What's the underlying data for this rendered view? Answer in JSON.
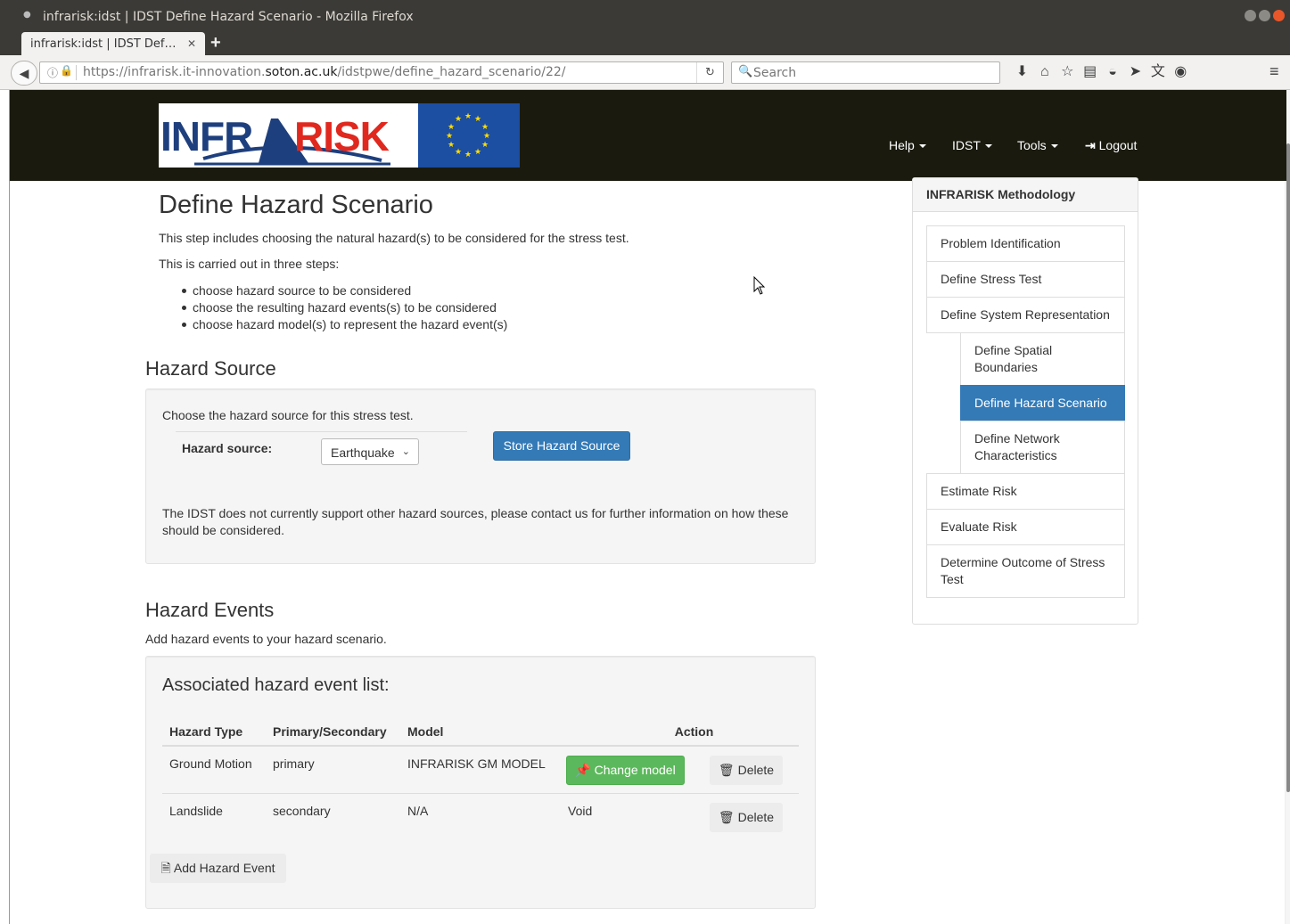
{
  "window": {
    "title": "infrarisk:idst | IDST Define Hazard Scenario - Mozilla Firefox",
    "tab_title": "infrarisk:idst | IDST Def…"
  },
  "browser": {
    "url_prefix": "https://infrarisk.it-innovation.",
    "url_domain": "soton.ac.uk",
    "url_path": "/idstpwe/define_hazard_scenario/22/",
    "search_placeholder": "Search"
  },
  "header": {
    "logo_left": "INFR",
    "logo_right": "RISK",
    "nav": [
      {
        "label": "Help"
      },
      {
        "label": "IDST"
      },
      {
        "label": "Tools"
      }
    ],
    "logout": "Logout"
  },
  "main": {
    "title": "Define Hazard Scenario",
    "intro": "This step includes choosing the natural hazard(s) to be considered for the stress test.",
    "steps_intro": "This is carried out in three steps:",
    "steps": [
      "choose hazard source to be considered",
      "choose the resulting hazard events(s) to be considered",
      "choose hazard model(s) to represent the hazard event(s)"
    ]
  },
  "hazard_source": {
    "heading": "Hazard Source",
    "prompt": "Choose the hazard source for this stress test.",
    "label": "Hazard source:",
    "selected": "Earthquake",
    "store_button": "Store Hazard Source",
    "note": "The IDST does not currently support other hazard sources, please contact us for further information on how these should be considered."
  },
  "hazard_events": {
    "heading": "Hazard Events",
    "intro": "Add hazard events to your hazard scenario.",
    "list_title": "Associated hazard event list:",
    "columns": [
      "Hazard Type",
      "Primary/Secondary",
      "Model",
      "Action"
    ],
    "rows": [
      {
        "type": "Ground Motion",
        "level": "primary",
        "model": "INFRARISK GM MODEL",
        "action": "Change model",
        "delete": "Delete"
      },
      {
        "type": "Landslide",
        "level": "secondary",
        "model": "N/A",
        "action": "Void",
        "delete": "Delete"
      }
    ],
    "add_button": "Add Hazard Event"
  },
  "sidebar": {
    "heading": "INFRARISK Methodology",
    "items": [
      {
        "label": "Problem Identification"
      },
      {
        "label": "Define Stress Test"
      },
      {
        "label": "Define System Representation"
      },
      {
        "label": "Define Spatial Boundaries"
      },
      {
        "label": "Define Hazard Scenario"
      },
      {
        "label": "Define Network Characteristics"
      },
      {
        "label": "Estimate Risk"
      },
      {
        "label": "Evaluate Risk"
      },
      {
        "label": "Determine Outcome of Stress Test"
      }
    ]
  },
  "colors": {
    "navbar": "#1a1a0f",
    "primary": "#337ab7",
    "success": "#5cb85c",
    "logo_blue": "#1e3f7d",
    "logo_red": "#e0281f",
    "eu_blue": "#1c4ea2"
  }
}
